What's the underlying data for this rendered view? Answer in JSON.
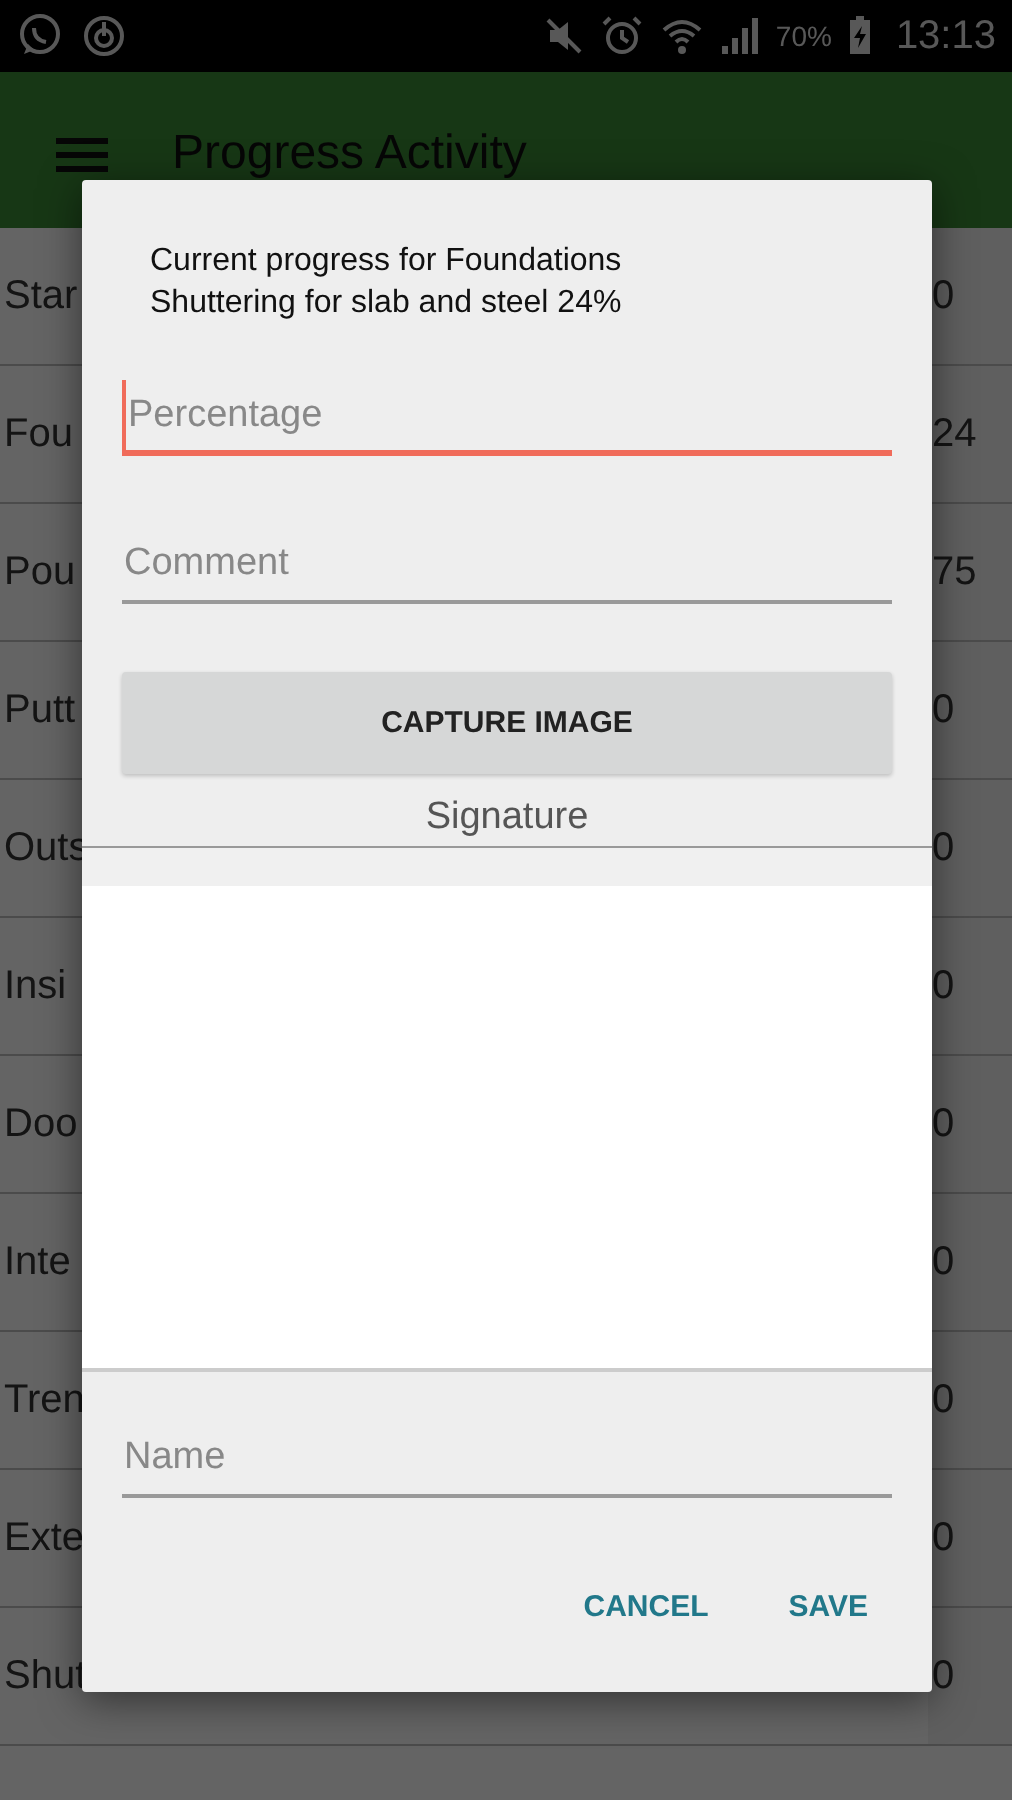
{
  "status_bar": {
    "battery": "70%",
    "time": "13:13"
  },
  "app_bar": {
    "title": "Progress Activity"
  },
  "rows": [
    {
      "label": "Star",
      "value": "0"
    },
    {
      "label": "Fou",
      "value": "24"
    },
    {
      "label": "Pou",
      "value": "75"
    },
    {
      "label": "Putt",
      "value": "0"
    },
    {
      "label": "Outs",
      "value": "0"
    },
    {
      "label": "Insi",
      "value": "0"
    },
    {
      "label": "Doo",
      "value": "0"
    },
    {
      "label": "Inte",
      "value": "0"
    },
    {
      "label": "Tren",
      "value": "0"
    },
    {
      "label": "Exte",
      "value": "0"
    },
    {
      "label": "Shut",
      "value": "0"
    }
  ],
  "dialog": {
    "message": "Current progress for Foundations Shuttering for slab and steel 24%",
    "fields": [
      {
        "placeholder": "Percentage",
        "focused": true
      },
      {
        "placeholder": "Comment",
        "focused": false
      }
    ],
    "capture_button": "CAPTURE IMAGE",
    "signature_label": "Signature",
    "name_field": {
      "placeholder": "Name",
      "focused": false
    },
    "actions": [
      "CANCEL",
      "SAVE"
    ]
  }
}
